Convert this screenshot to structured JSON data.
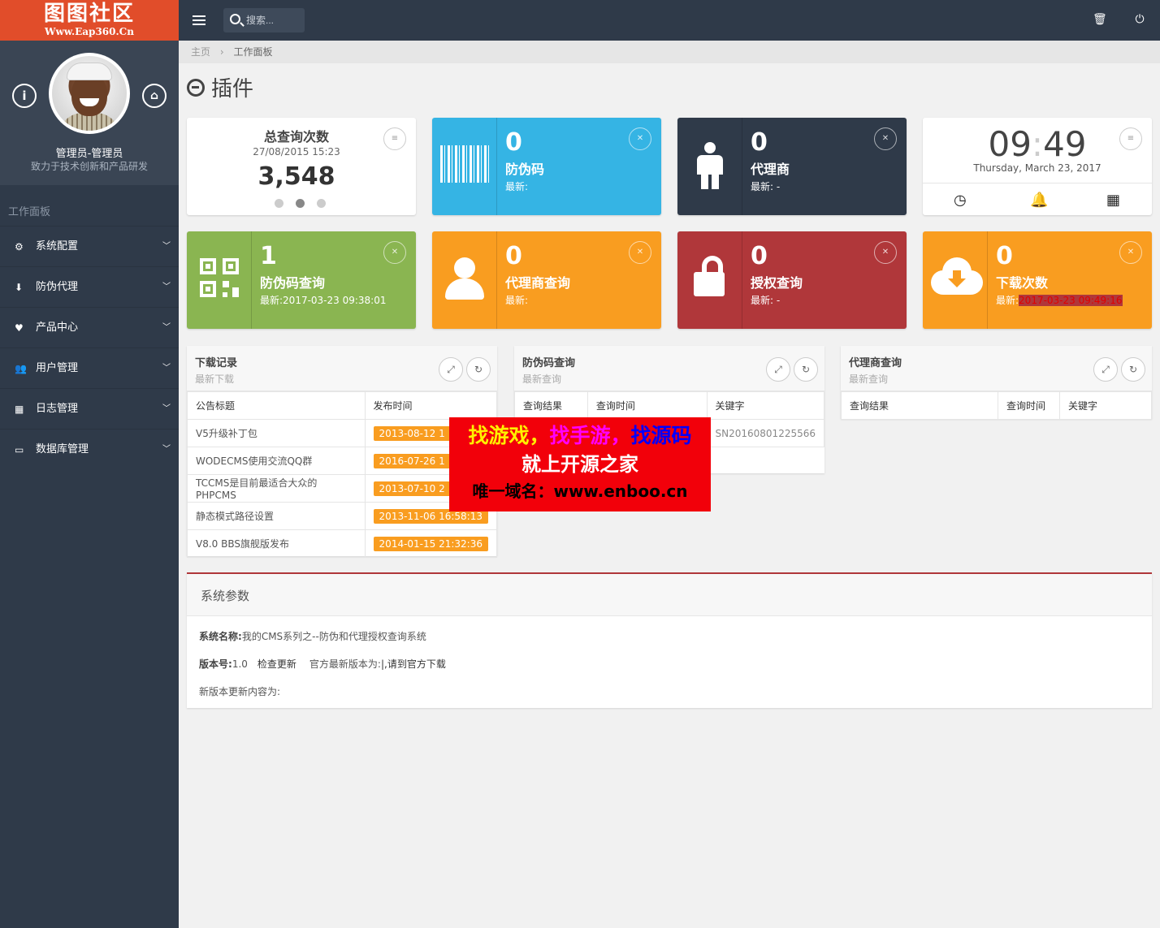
{
  "logo": {
    "title": "图图社区",
    "subtitle": "Www.Eap360.Cn"
  },
  "profile": {
    "name": "管理员-管理员",
    "desc": "致力于技术创新和产品研发",
    "info_icon": "info-icon",
    "home_icon": "home-icon"
  },
  "sidebar": {
    "title": "工作面板",
    "items": [
      {
        "label": "系统配置",
        "icon": "gears-icon"
      },
      {
        "label": "防伪代理",
        "icon": "download-icon"
      },
      {
        "label": "产品中心",
        "icon": "heart-icon"
      },
      {
        "label": "用户管理",
        "icon": "users-icon"
      },
      {
        "label": "日志管理",
        "icon": "building-icon"
      },
      {
        "label": "数据库管理",
        "icon": "hdd-icon"
      }
    ]
  },
  "topbar": {
    "search_placeholder": "搜索...",
    "trash_icon": "trash-icon",
    "power_icon": "power-icon"
  },
  "breadcrumb": {
    "home": "主页",
    "sep": "›",
    "current": "工作面板"
  },
  "page_title": "插件",
  "stats": {
    "total": {
      "title": "总查询次数",
      "date": "27/08/2015 15:23",
      "value": "3,548"
    },
    "fangweima": {
      "num": "0",
      "label": "防伪码",
      "sub": "最新:"
    },
    "dailishang": {
      "num": "0",
      "label": "代理商",
      "sub": "最新: -"
    },
    "fwm_query": {
      "num": "1",
      "label": "防伪码查询",
      "sub": "最新:2017-03-23 09:38:01"
    },
    "dls_query": {
      "num": "0",
      "label": "代理商查询",
      "sub": "最新:"
    },
    "auth_query": {
      "num": "0",
      "label": "授权查询",
      "sub": "最新: -"
    },
    "downloads": {
      "num": "0",
      "label": "下载次数",
      "sub_prefix": "最新:",
      "sub_value": "2017-03-23 09:49:16"
    }
  },
  "clock": {
    "time_h": "09",
    "sep": ":",
    "time_m": "49",
    "date": "Thursday, March 23, 2017"
  },
  "panels": {
    "download": {
      "title": "下载记录",
      "subtitle": "最新下载",
      "headers": [
        "公告标题",
        "发布时间"
      ],
      "rows": [
        [
          "V5升级补丁包",
          "2013-08-12 1"
        ],
        [
          "WODECMS使用交流QQ群",
          "2016-07-26 1"
        ],
        [
          "TCCMS是目前最适合大众的PHPCMS",
          "2013-07-10 2"
        ],
        [
          "静态模式路径设置",
          "2013-11-06 16:58:13"
        ],
        [
          "V8.0 BBS旗舰版发布",
          "2014-01-15 21:32:36"
        ]
      ]
    },
    "fwm": {
      "title": "防伪码查询",
      "subtitle": "最新查询",
      "headers": [
        "查询结果",
        "查询时间",
        "关键字"
      ],
      "rows": [
        [
          "",
          "",
          "SN20160801225566"
        ]
      ]
    },
    "dls": {
      "title": "代理商查询",
      "subtitle": "最新查询",
      "headers": [
        "查询结果",
        "查询时间",
        "关键字"
      ]
    }
  },
  "system": {
    "title": "系统参数",
    "name_label": "系统名称:",
    "name_value": "我的CMS系列之--防伪和代理授权查询系统",
    "version_label": "版本号:",
    "version_value": "1.0",
    "check_update": "检查更新",
    "latest_label": "官方最新版本为:",
    "latest_link": "|,请到官方下载",
    "changelog_label": "新版本更新内容为:"
  },
  "ad": {
    "part1": "找游戏，",
    "part2": "找手游，",
    "part3": "找源码",
    "line2": "就上开源之家",
    "line3": "唯一域名：www.enboo.cn"
  },
  "colors": {
    "sidebar": "#2f3a49",
    "logo": "#e14d2a",
    "blue": "#35b4e4",
    "green": "#8ab551",
    "orange": "#f99d20",
    "red": "#b0373a"
  }
}
